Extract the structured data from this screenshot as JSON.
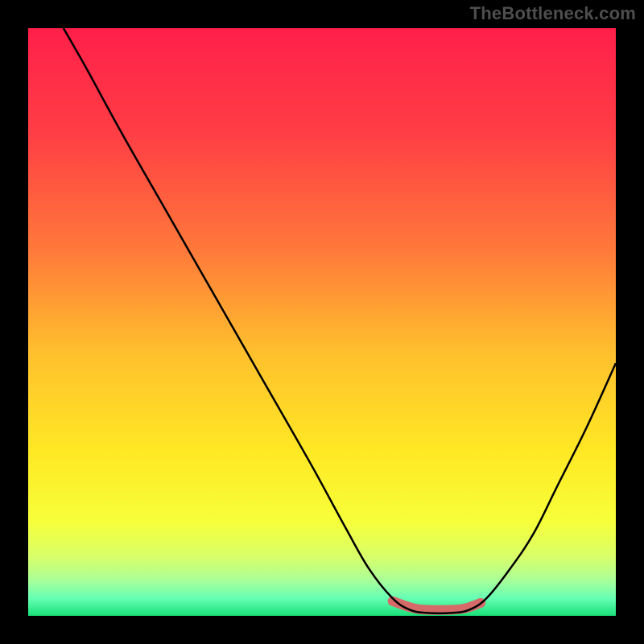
{
  "watermark": "TheBottleneck.com",
  "gradient_stops": [
    {
      "offset": 0,
      "color": "#ff1f4a"
    },
    {
      "offset": 18,
      "color": "#ff3e45"
    },
    {
      "offset": 38,
      "color": "#ff7a3a"
    },
    {
      "offset": 55,
      "color": "#ffbf2d"
    },
    {
      "offset": 72,
      "color": "#ffe824"
    },
    {
      "offset": 84,
      "color": "#f6ff3a"
    },
    {
      "offset": 90,
      "color": "#d8ff6a"
    },
    {
      "offset": 94,
      "color": "#a8ff99"
    },
    {
      "offset": 97,
      "color": "#66ffb4"
    },
    {
      "offset": 100,
      "color": "#19e079"
    }
  ],
  "highlight": {
    "color": "#d66a68",
    "stroke_width": 12
  },
  "curve": {
    "color": "#000000",
    "stroke_width": 2.5
  },
  "chart_data": {
    "type": "line",
    "title": "",
    "xlabel": "",
    "ylabel": "",
    "xlim": [
      0,
      100
    ],
    "ylim": [
      0,
      100
    ],
    "series": [
      {
        "name": "bottleneck-curve",
        "points": [
          {
            "x": 6,
            "y": 100
          },
          {
            "x": 10,
            "y": 93
          },
          {
            "x": 16,
            "y": 82
          },
          {
            "x": 24,
            "y": 68
          },
          {
            "x": 32,
            "y": 54
          },
          {
            "x": 40,
            "y": 40
          },
          {
            "x": 48,
            "y": 26
          },
          {
            "x": 54,
            "y": 15
          },
          {
            "x": 58,
            "y": 8
          },
          {
            "x": 62,
            "y": 3
          },
          {
            "x": 65,
            "y": 1
          },
          {
            "x": 68,
            "y": 0.5
          },
          {
            "x": 72,
            "y": 0.5
          },
          {
            "x": 75,
            "y": 1
          },
          {
            "x": 78,
            "y": 3
          },
          {
            "x": 82,
            "y": 8
          },
          {
            "x": 86,
            "y": 14
          },
          {
            "x": 90,
            "y": 22
          },
          {
            "x": 95,
            "y": 32
          },
          {
            "x": 100,
            "y": 43
          }
        ]
      },
      {
        "name": "optimal-range-highlight",
        "points": [
          {
            "x": 62,
            "y": 2.5
          },
          {
            "x": 66,
            "y": 1.2
          },
          {
            "x": 70,
            "y": 1.0
          },
          {
            "x": 74,
            "y": 1.2
          },
          {
            "x": 77,
            "y": 2.2
          }
        ]
      }
    ]
  }
}
